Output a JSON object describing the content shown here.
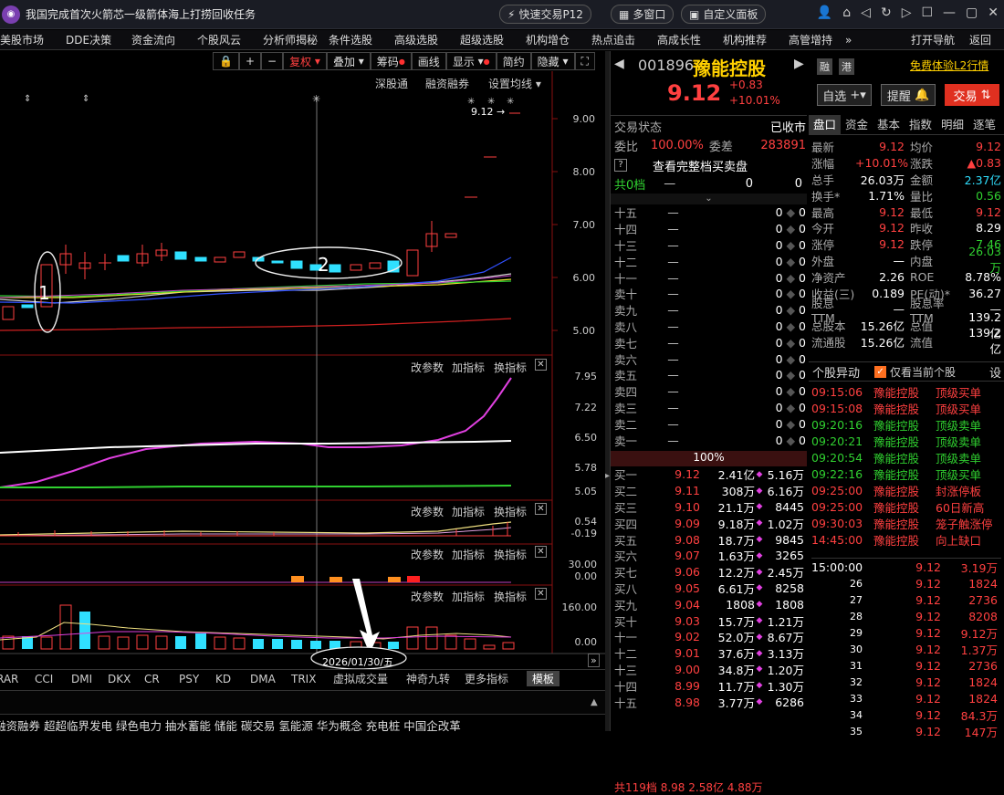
{
  "window": {
    "title": "我国完成首次火箭芯一级箭体海上打捞回收任务",
    "btn_quick": "快速交易P12",
    "btn_multi": "多窗口",
    "btn_custom": "自定义面板"
  },
  "menu": [
    "美股市场",
    "DDE决策",
    "资金流向",
    "个股风云",
    "分析师揭秘",
    "条件选股",
    "高级选股",
    "超级选股",
    "机构增仓",
    "热点追击",
    "高成长性",
    "机构推荐",
    "高管增持",
    "»",
    "打开导航",
    "返回"
  ],
  "chart_toolbar": {
    "fq": "复权",
    "overlay": "叠加",
    "chip": "筹码",
    "line": "画线",
    "display": "显示",
    "simple": "简约",
    "hide": "隐藏"
  },
  "chart_header": {
    "tab1": "深股通",
    "tab2": "融资融券",
    "tab3": "设置均线"
  },
  "price_marker": "9.12",
  "price_axis": [
    "9.00",
    "8.00",
    "7.00",
    "6.00",
    "5.00"
  ],
  "annotations": {
    "a1": "1",
    "a2": "2"
  },
  "panels": {
    "p2_axis": [
      "7.95",
      "7.22",
      "6.50",
      "5.78",
      "5.05"
    ],
    "p3_axis": [
      "0.54",
      "-0.19"
    ],
    "p4_axis": [
      "30.00",
      "0.00"
    ],
    "p5_axis": [
      "160.00",
      "0.00"
    ],
    "btn_param": "改参数",
    "btn_add": "加指标",
    "btn_switch": "换指标"
  },
  "date_label": "2026/01/30/五",
  "indicator_tabs": [
    "RAR",
    "CCI",
    "DMI",
    "DKX",
    "CR",
    "PSY",
    "KD",
    "DMA",
    "TRIX",
    "虚拟成交量",
    "神奇九转",
    "更多指标",
    "模板"
  ],
  "news_ticker": "融资融券  超超临界发电  绿色电力  抽水蓄能  储能  碳交易  氢能源  华为概念  充电桩  中国企改革",
  "stock": {
    "code": "001896",
    "name": "豫能控股",
    "price": "9.12",
    "change": "+0.83",
    "change_pct": "+10.01%",
    "tag1": "融",
    "tag2": "港",
    "l2_link": "免费体验L2行情",
    "btn_watch": "自选",
    "btn_alert": "提醒",
    "btn_trade": "交易"
  },
  "order": {
    "status_label": "交易状态",
    "status": "已收市",
    "ratio_label": "委比",
    "ratio": "100.00%",
    "diff_label": "委差",
    "diff": "283891",
    "view_full": "查看完整档买卖盘",
    "total_label": "共0档",
    "sell_levels": [
      "十五",
      "十四",
      "十三",
      "十二",
      "十一",
      "卖十",
      "卖九",
      "卖八",
      "卖七",
      "卖六",
      "卖五",
      "卖四",
      "卖三",
      "卖二",
      "卖一"
    ],
    "pct_bar": "100%",
    "buys": [
      {
        "lvl": "买一",
        "p": "9.12",
        "v": "2.41亿",
        "c": "5.16万"
      },
      {
        "lvl": "买二",
        "p": "9.11",
        "v": "308万",
        "c": "6.16万"
      },
      {
        "lvl": "买三",
        "p": "9.10",
        "v": "21.1万",
        "c": "8445"
      },
      {
        "lvl": "买四",
        "p": "9.09",
        "v": "9.18万",
        "c": "1.02万"
      },
      {
        "lvl": "买五",
        "p": "9.08",
        "v": "18.7万",
        "c": "9845"
      },
      {
        "lvl": "买六",
        "p": "9.07",
        "v": "1.63万",
        "c": "3265"
      },
      {
        "lvl": "买七",
        "p": "9.06",
        "v": "12.2万",
        "c": "2.45万"
      },
      {
        "lvl": "买八",
        "p": "9.05",
        "v": "6.61万",
        "c": "8258"
      },
      {
        "lvl": "买九",
        "p": "9.04",
        "v": "1808",
        "c": "1808"
      },
      {
        "lvl": "买十",
        "p": "9.03",
        "v": "15.7万",
        "c": "1.21万"
      },
      {
        "lvl": "十一",
        "p": "9.02",
        "v": "52.0万",
        "c": "8.67万"
      },
      {
        "lvl": "十二",
        "p": "9.01",
        "v": "37.6万",
        "c": "3.13万"
      },
      {
        "lvl": "十三",
        "p": "9.00",
        "v": "34.8万",
        "c": "1.20万"
      },
      {
        "lvl": "十四",
        "p": "8.99",
        "v": "11.7万",
        "c": "1.30万"
      },
      {
        "lvl": "十五",
        "p": "8.98",
        "v": "3.77万",
        "c": "6286"
      }
    ],
    "footer": "共119档  8.98  2.58亿  4.88万"
  },
  "quote_tabs": [
    "盘口",
    "资金",
    "基本",
    "指数",
    "明细",
    "逐笔"
  ],
  "quote": [
    [
      "最新",
      "9.12",
      "均价",
      "9.12"
    ],
    [
      "涨幅",
      "+10.01%",
      "涨跌",
      "▲0.83"
    ],
    [
      "总手",
      "26.03万",
      "金额",
      "2.37亿"
    ],
    [
      "换手*",
      "1.71%",
      "量比",
      "0.56"
    ],
    [
      "最高",
      "9.12",
      "最低",
      "9.12"
    ],
    [
      "今开",
      "9.12",
      "昨收",
      "8.29"
    ],
    [
      "涨停",
      "9.12",
      "跌停",
      "7.46"
    ],
    [
      "外盘",
      "—",
      "内盘",
      "26.03万"
    ],
    [
      "净资产",
      "2.26",
      "ROE",
      "8.78%"
    ],
    [
      "收益(三)",
      "0.189",
      "PE(动)*",
      "36.27"
    ],
    [
      "股息TTM",
      "—",
      "股息率TTM",
      "—"
    ],
    [
      "总股本",
      "15.26亿",
      "总值",
      "139.2亿"
    ],
    [
      "流通股",
      "15.26亿",
      "流值",
      "139.2亿"
    ]
  ],
  "movement": {
    "title": "个股异动",
    "filter": "仅看当前个股",
    "settings": "设",
    "items": [
      {
        "t": "09:15:06",
        "n": "豫能控股",
        "e": "顶级买单",
        "c": "red"
      },
      {
        "t": "09:15:08",
        "n": "豫能控股",
        "e": "顶级买单",
        "c": "red"
      },
      {
        "t": "09:20:16",
        "n": "豫能控股",
        "e": "顶级卖单",
        "c": "green"
      },
      {
        "t": "09:20:21",
        "n": "豫能控股",
        "e": "顶级卖单",
        "c": "green"
      },
      {
        "t": "09:20:54",
        "n": "豫能控股",
        "e": "顶级卖单",
        "c": "green"
      },
      {
        "t": "09:22:16",
        "n": "豫能控股",
        "e": "顶级买单",
        "c": "green"
      },
      {
        "t": "09:25:00",
        "n": "豫能控股",
        "e": "封涨停板",
        "c": "red"
      },
      {
        "t": "09:25:00",
        "n": "豫能控股",
        "e": "60日新高",
        "c": "red"
      },
      {
        "t": "09:30:03",
        "n": "豫能控股",
        "e": "笼子触涨停",
        "c": "red"
      },
      {
        "t": "14:45:00",
        "n": "豫能控股",
        "e": "向上缺口",
        "c": "red"
      }
    ]
  },
  "ticks": [
    {
      "t": "15:00:00",
      "p": "9.12",
      "v": "3.19万"
    },
    {
      "t": "26",
      "p": "9.12",
      "v": "1824"
    },
    {
      "t": "27",
      "p": "9.12",
      "v": "2736"
    },
    {
      "t": "28",
      "p": "9.12",
      "v": "8208"
    },
    {
      "t": "29",
      "p": "9.12",
      "v": "9.12万"
    },
    {
      "t": "30",
      "p": "9.12",
      "v": "1.37万"
    },
    {
      "t": "31",
      "p": "9.12",
      "v": "2736"
    },
    {
      "t": "32",
      "p": "9.12",
      "v": "1824"
    },
    {
      "t": "33",
      "p": "9.12",
      "v": "1824"
    },
    {
      "t": "34",
      "p": "9.12",
      "v": "84.3万"
    },
    {
      "t": "35",
      "p": "9.12",
      "v": "147万"
    }
  ]
}
